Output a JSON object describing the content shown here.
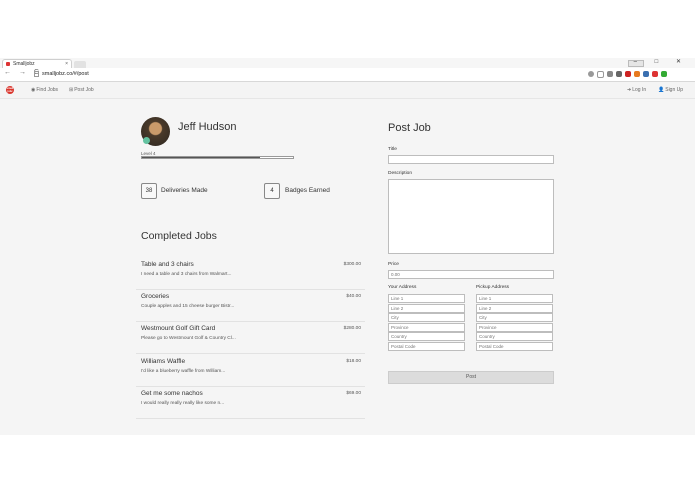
{
  "browser": {
    "tab_title": "Smalljobz",
    "tab_close": "×",
    "window_controls": "– □ ✕",
    "nav_icons": "← → C",
    "url": "smalljobz.co/#/post"
  },
  "appnav": {
    "logo_text": "small jobz",
    "find_jobs": "Find Jobs",
    "post_job": "Post Job",
    "log_in": "Log In",
    "sign_up": "Sign Up"
  },
  "profile": {
    "name": "Jeff Hudson",
    "level_label": "Level 4",
    "level_progress": 0.78,
    "deliveries_count": "38",
    "deliveries_label": "Deliveries Made",
    "badges_count": "4",
    "badges_label": "Badges Earned"
  },
  "completed": {
    "heading": "Completed Jobs",
    "jobs": [
      {
        "title": "Table and 3 chairs",
        "price": "$300.00",
        "desc": "I need a table and 3 chairs from Walmart..."
      },
      {
        "title": "Groceries",
        "price": "$40.00",
        "desc": "Couple apples and 15 cheese burger Bistr..."
      },
      {
        "title": "Westmount Golf Gift Card",
        "price": "$280.00",
        "desc": "Please go to Westmount Golf & Country Cl..."
      },
      {
        "title": "Williams Waffle",
        "price": "$18.00",
        "desc": "I'd like a blueberry waffle from William..."
      },
      {
        "title": "Get me some nachos",
        "price": "$69.00",
        "desc": "I would really really really like some n..."
      }
    ]
  },
  "post_form": {
    "heading": "Post Job",
    "title_label": "Title",
    "description_label": "Description",
    "price_label": "Price",
    "price_placeholder": "0.00",
    "your_address_label": "Your Address",
    "pickup_address_label": "Pickup Address",
    "address_placeholders": [
      "Line 1",
      "Line 2",
      "City",
      "Province",
      "Country",
      "Postal Code"
    ],
    "submit_label": "Post"
  },
  "colors": {
    "brand": "#d9342b",
    "page_background": "#f5f5f5",
    "level_bar_fill": "#555555"
  }
}
